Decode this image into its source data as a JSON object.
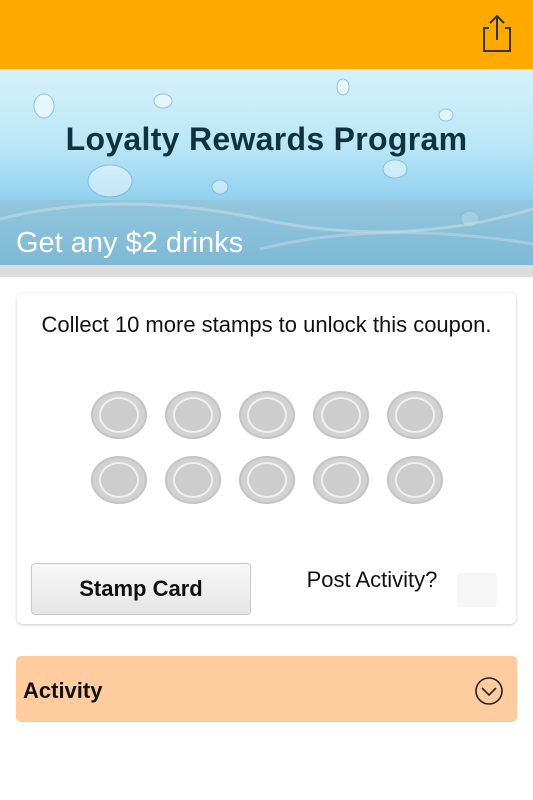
{
  "topbar": {
    "share_icon": "share-icon",
    "bg_color": "#FFAA00"
  },
  "banner": {
    "title": "Loyalty Rewards Program",
    "subtitle": "Get any $2 drinks"
  },
  "card": {
    "message": "Collect 10 more stamps to unlock this coupon.",
    "stamps_collected": 0,
    "stamps_total": 10,
    "stamp_card_button": "Stamp Card",
    "post_activity_label": "Post Activity?"
  },
  "activity": {
    "label": "Activity",
    "icon": "chevron-down-circle-icon",
    "bg_color": "#FFCCA0"
  }
}
